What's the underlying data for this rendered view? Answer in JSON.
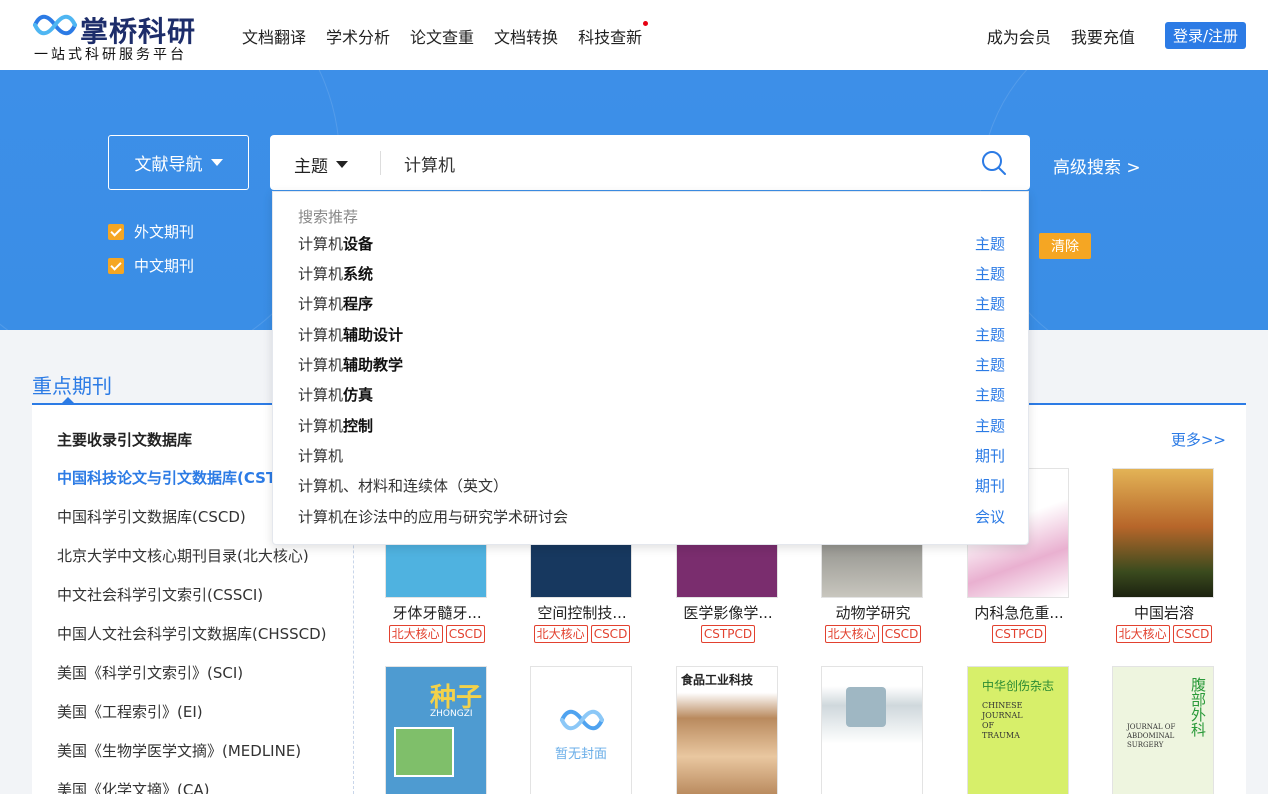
{
  "header": {
    "logo_title": "掌桥科研",
    "logo_sub": "一站式科研服务平台",
    "nav": [
      "文档翻译",
      "学术分析",
      "论文查重",
      "文档转换",
      "科技查新"
    ],
    "member": "成为会员",
    "recharge": "我要充值",
    "login": "登录/注册"
  },
  "search": {
    "nav_label": "文献导航",
    "type": "主题",
    "query": "计算机",
    "advanced": "高级搜索 >",
    "checks": [
      "外文期刊",
      "中文期刊"
    ],
    "clear": "清除"
  },
  "dropdown": {
    "heading": "搜索推荐",
    "items": [
      {
        "prefix": "计算机",
        "bold": "设备",
        "kind": "主题"
      },
      {
        "prefix": "计算机",
        "bold": "系统",
        "kind": "主题"
      },
      {
        "prefix": "计算机",
        "bold": "程序",
        "kind": "主题"
      },
      {
        "prefix": "计算机",
        "bold": "辅助设计",
        "kind": "主题"
      },
      {
        "prefix": "计算机",
        "bold": "辅助教学",
        "kind": "主题"
      },
      {
        "prefix": "计算机",
        "bold": "仿真",
        "kind": "主题"
      },
      {
        "prefix": "计算机",
        "bold": "控制",
        "kind": "主题"
      },
      {
        "prefix": "计算机",
        "bold": "",
        "kind": "期刊"
      },
      {
        "prefix": "计算机、材料和连续体（英文）",
        "bold": "",
        "kind": "期刊"
      },
      {
        "prefix": "计算机在诊法中的应用与研究学术研讨会",
        "bold": "",
        "kind": "会议"
      }
    ]
  },
  "section": {
    "title": "重点期刊",
    "left_head": "主要收录引文数据库",
    "more": "更多>>",
    "databases": [
      "中国科技论文与引文数据库(CSTPCD)",
      "中国科学引文数据库(CSCD)",
      "北京大学中文核心期刊目录(北大核心)",
      "中文社会科学引文索引(CSSCI)",
      "中国人文社会科学引文数据库(CHSSCD)",
      "美国《科学引文索引》(SCI)",
      "美国《工程索引》(EI)",
      "美国《生物学医学文摘》(MEDLINE)",
      "美国《化学文摘》(CA)"
    ],
    "journals_row1": [
      {
        "name": "牙体牙髓牙...",
        "tags": [
          "北大核心",
          "CSCD"
        ],
        "color": "#4fb2e0"
      },
      {
        "name": "空间控制技...",
        "tags": [
          "北大核心",
          "CSCD"
        ],
        "color": "#17385f"
      },
      {
        "name": "医学影像学...",
        "tags": [
          "CSTPCD"
        ],
        "color": "#7a2d6e"
      },
      {
        "name": "动物学研究",
        "tags": [
          "北大核心",
          "CSCD"
        ],
        "color": "#8b8b86"
      },
      {
        "name": "内科急危重...",
        "tags": [
          "CSTPCD"
        ],
        "color": "#e9b0d0"
      },
      {
        "name": "中国岩溶",
        "tags": [
          "北大核心",
          "CSCD"
        ],
        "color": "#b7662a"
      }
    ],
    "journals_row2": [
      {
        "cover_text": "种子",
        "cover_sub": "ZHONGZI",
        "color": "#4e9bd1"
      },
      {
        "cover_text": "暂无封面",
        "cover_sub": "",
        "color": "#ffffff"
      },
      {
        "cover_text": "食品工业科技",
        "cover_sub": "",
        "color": "#b98a5e"
      },
      {
        "cover_text": "",
        "cover_sub": "",
        "color": "#cfd8dc"
      },
      {
        "cover_text": "中华创伤杂志",
        "cover_sub": "CHINESE JOURNAL OF TRAUMA",
        "color": "#d7ef6a"
      },
      {
        "cover_text": "腹部外科",
        "cover_sub": "JOURNAL OF ABDOMINAL SURGERY",
        "color": "#eef5df"
      }
    ]
  }
}
